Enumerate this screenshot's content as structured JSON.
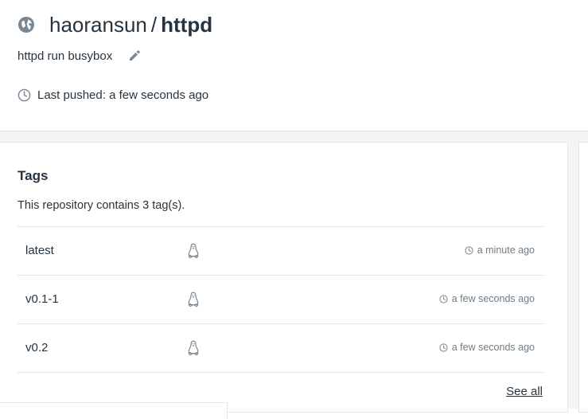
{
  "repo": {
    "namespace": "haoransun",
    "separator": "/",
    "name": "httpd",
    "description": "httpd run busybox",
    "last_pushed": "Last pushed: a few seconds ago"
  },
  "tags": {
    "title": "Tags",
    "count_text": "This repository contains 3 tag(s).",
    "rows": [
      {
        "name": "latest",
        "os_icon": "linux-tux-icon",
        "time": "a minute ago"
      },
      {
        "name": "v0.1-1",
        "os_icon": "linux-tux-icon",
        "time": "a few seconds ago"
      },
      {
        "name": "v0.2",
        "os_icon": "linux-tux-icon",
        "time": "a few seconds ago"
      }
    ],
    "see_all": "See all"
  },
  "colors": {
    "text": "#27343f",
    "muted": "#6f7d87",
    "icon": "#7a8690",
    "border": "#dfe3e6",
    "background": "#f2f4f6"
  }
}
